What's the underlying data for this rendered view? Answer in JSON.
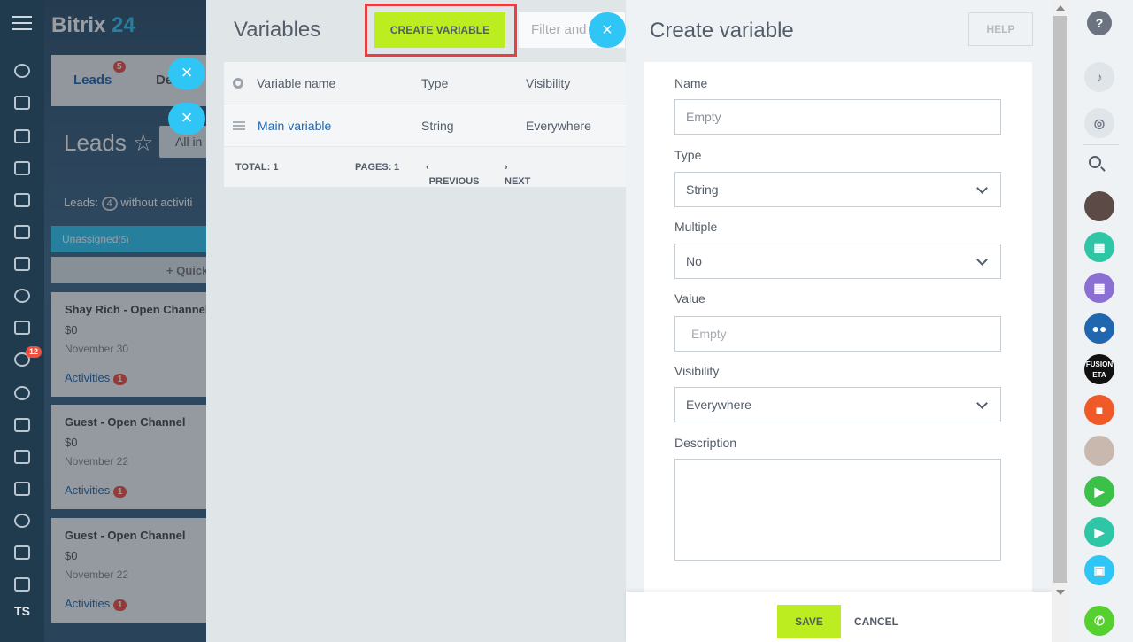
{
  "left_nav": {
    "badge_count": "12",
    "user_initials": "TS"
  },
  "crm": {
    "brand_name": "Bitrix",
    "brand_number": "24",
    "tab_leads": "Leads",
    "tab_leads_badge": "5",
    "tab_deals_partial": "De",
    "page_title": "Leads",
    "filter_chip": "All in",
    "leads_counter_label": "Leads:",
    "leads_counter_value": "4",
    "leads_counter_suffix": "without activiti",
    "stage_name": "Unassigned",
    "stage_count": "(5)",
    "quick_label": "+ Quick",
    "cards": [
      {
        "title": "Shay Rich - Open Channel",
        "price": "$0",
        "date": "November 30",
        "activities_label": "Activities",
        "activities_count": "1"
      },
      {
        "title": "Guest - Open Channel",
        "price": "$0",
        "date": "November 22",
        "activities_label": "Activities",
        "activities_count": "1"
      },
      {
        "title": "Guest - Open Channel",
        "price": "$0",
        "date": "November 22",
        "activities_label": "Activities",
        "activities_count": "1"
      }
    ]
  },
  "variables_panel": {
    "title": "Variables",
    "create_button": "CREATE VARIABLE",
    "filter_placeholder": "Filter and",
    "columns": [
      "Variable name",
      "Type",
      "Visibility"
    ],
    "rows": [
      {
        "name": "Main variable",
        "type": "String",
        "visibility": "Everywhere"
      }
    ],
    "footer": {
      "total": "TOTAL: 1",
      "pages_label": "PAGES:",
      "pages_value": "1",
      "previous": "PREVIOUS",
      "next": "NEXT"
    }
  },
  "create_variable": {
    "title": "Create variable",
    "help_button": "HELP",
    "fields": {
      "name": {
        "label": "Name",
        "placeholder": "Empty"
      },
      "type": {
        "label": "Type",
        "value": "String"
      },
      "multiple": {
        "label": "Multiple",
        "value": "No"
      },
      "value": {
        "label": "Value",
        "placeholder": "Empty"
      },
      "visibility": {
        "label": "Visibility",
        "value": "Everywhere"
      },
      "description": {
        "label": "Description",
        "value": ""
      }
    },
    "save_button": "SAVE",
    "cancel_button": "CANCEL"
  },
  "right_bar": {
    "help_symbol": "?",
    "partial_logo_text": "FUSION ETA"
  },
  "colors": {
    "accent_green": "#bbed21",
    "accent_blue": "#2fc6f6",
    "badge_red": "#f04e3e",
    "highlight_red": "#e64046",
    "nav_dark": "#203a4e"
  }
}
